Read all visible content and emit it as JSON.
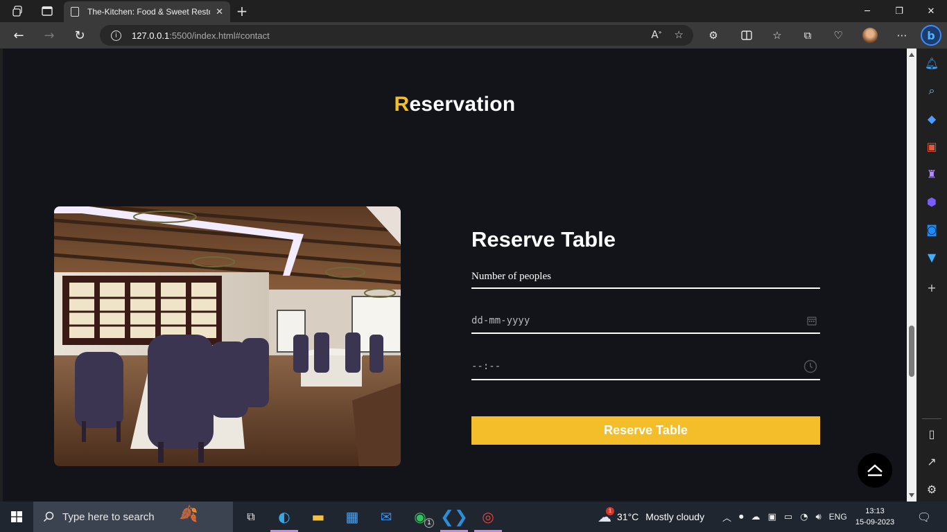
{
  "browser": {
    "tab_title": "The-Kitchen: Food & Sweet Resto",
    "url_host": "127.0.0.1",
    "url_rest": ":5500/index.html#contact"
  },
  "page": {
    "section_title_first_letter": "R",
    "section_title_rest": "eservation",
    "image_alt": "Restaurant dining room interior",
    "form_title": "Reserve Table",
    "people_placeholder": "Number of peoples",
    "date_placeholder": "dd-mm-yyyy",
    "time_placeholder": "--:--",
    "reserve_button": "Reserve Table",
    "accent_color": "#f4bd2a",
    "background_color": "#13141a"
  },
  "taskbar": {
    "search_placeholder": "Type here to search",
    "weather_temp": "31°C",
    "weather_desc": "Mostly cloudy",
    "weather_badge": "1",
    "whatsapp_badge": "1",
    "language": "ENG",
    "time": "13:13",
    "date": "15-09-2023"
  }
}
